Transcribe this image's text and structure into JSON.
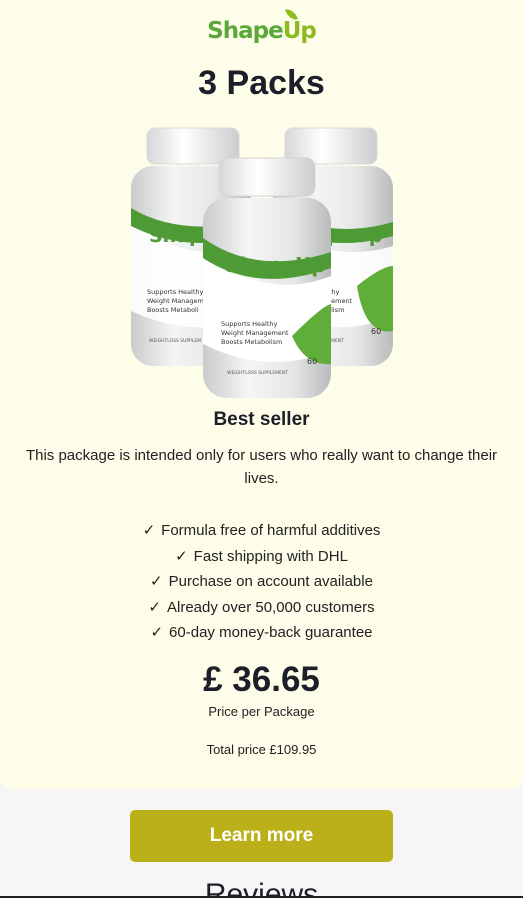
{
  "brand": {
    "logo_shape": "Shape",
    "logo_up": "Up"
  },
  "product": {
    "title": "3 Packs",
    "bottle_label": {
      "brand": "ShapeUp",
      "bullets": [
        "Supports Healthy",
        "Weight Management",
        "Boosts Metabolism"
      ],
      "footer": "WEIGHTLOSS SUPPLEMENT",
      "count": "60"
    },
    "badge": "Best seller",
    "description": "This package is intended only for users who really want to change their lives.",
    "features": [
      "Formula free of harmful additives",
      "Fast shipping with DHL",
      "Purchase on account available",
      "Already over 50,000 customers",
      "60-day money-back guarantee"
    ],
    "check_symbol": "✓",
    "price": "£ 36.65",
    "price_caption": "Price per Package",
    "total": "Total price £109.95"
  },
  "cta": {
    "label": "Learn more"
  },
  "reviews": {
    "heading": "Reviews"
  },
  "colors": {
    "card_bg": "#fdfde9",
    "page_bg": "#f6f6f6",
    "button": "#bcb01a",
    "brand_green": "#5aa83a",
    "brand_lime": "#8cbb1f"
  }
}
